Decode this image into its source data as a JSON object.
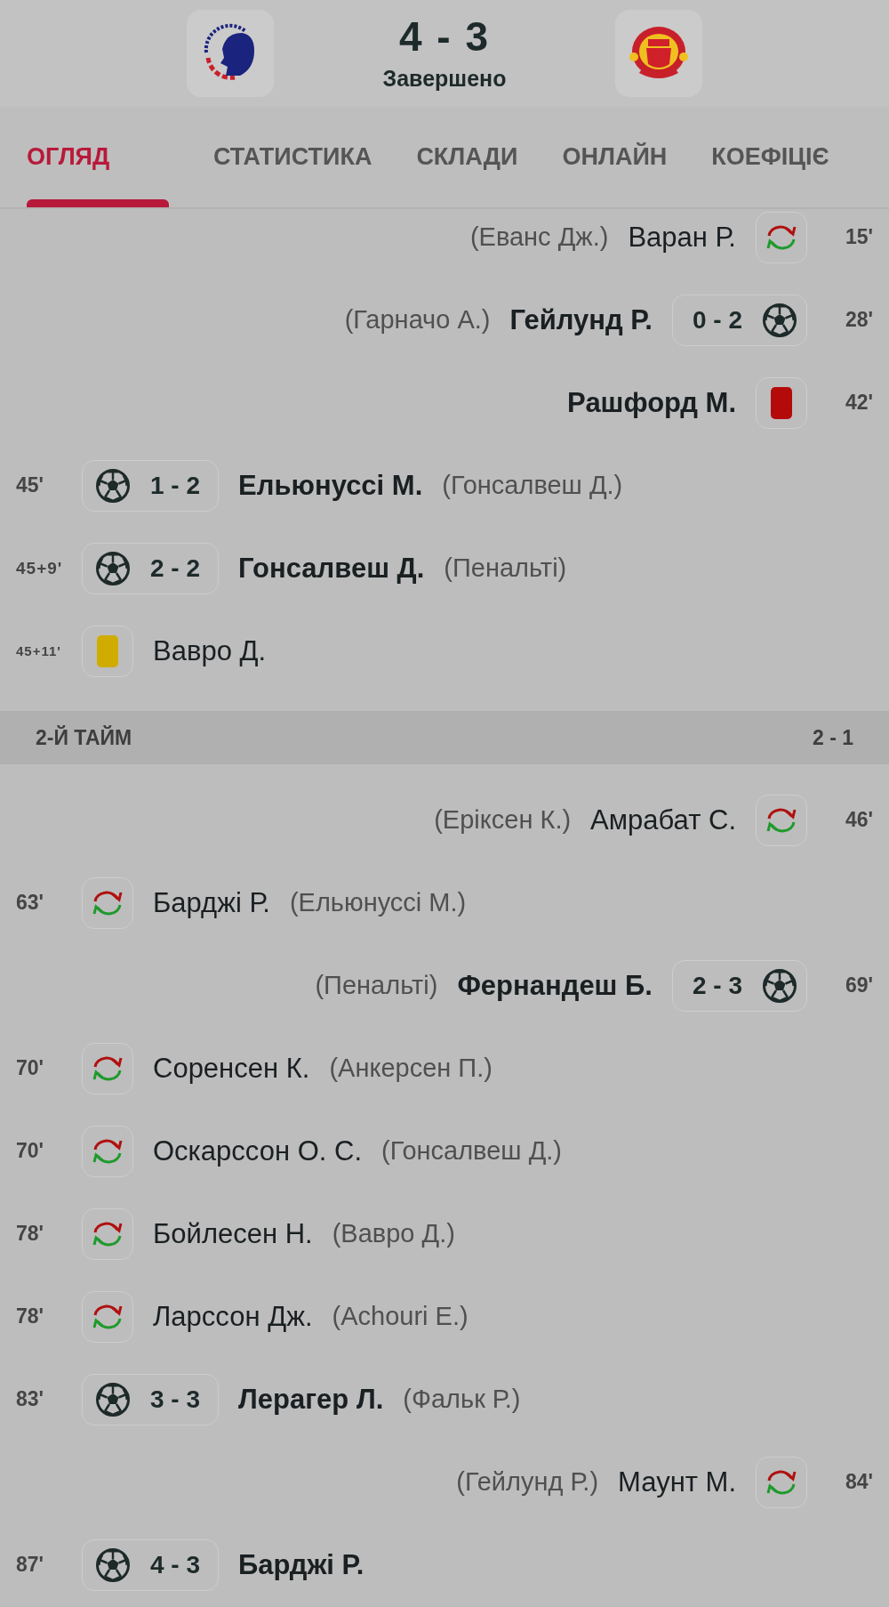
{
  "match": {
    "score": "4 - 3",
    "status": "Завершено"
  },
  "tabs": [
    {
      "label": "ОГЛЯД",
      "selected": true
    },
    {
      "label": "СТАТИСТИКА",
      "selected": false
    },
    {
      "label": "СКЛАДИ",
      "selected": false
    },
    {
      "label": "ОНЛАЙН",
      "selected": false
    },
    {
      "label": "КОЕФІЦІЄ",
      "selected": false
    }
  ],
  "timeline": [
    {
      "kind": "substitution",
      "away": true,
      "minute": "15'",
      "player": "Варан Р.",
      "note": "(Еванс Дж.)"
    },
    {
      "kind": "goal",
      "away": true,
      "minute": "28'",
      "player": "Гейлунд Р.",
      "note": "(Гарначо А.)",
      "score": "0 - 2"
    },
    {
      "kind": "red_card",
      "away": true,
      "minute": "42'",
      "player": "Рашфорд М."
    },
    {
      "kind": "goal",
      "away": false,
      "minute": "45'",
      "player": "Ельюнуссі М.",
      "note": "(Гонсалвеш Д.)",
      "score": "1 - 2"
    },
    {
      "kind": "goal",
      "away": false,
      "minute": "45+9'",
      "player": "Гонсалвеш Д.",
      "note": "(Пенальті)",
      "score": "2 - 2"
    },
    {
      "kind": "yellow_card",
      "away": false,
      "minute": "45+11'",
      "player": "Вавро Д."
    },
    {
      "kind": "period",
      "title": "2-Й ТАЙМ",
      "score": "2 - 1"
    },
    {
      "kind": "substitution",
      "away": true,
      "minute": "46'",
      "player": "Амрабат С.",
      "note": "(Еріксен К.)"
    },
    {
      "kind": "substitution",
      "away": false,
      "minute": "63'",
      "player": "Барджі Р.",
      "note": "(Ельюнуссі М.)"
    },
    {
      "kind": "goal",
      "away": true,
      "minute": "69'",
      "player": "Фернандеш Б.",
      "note": "(Пенальті)",
      "score": "2 - 3"
    },
    {
      "kind": "substitution",
      "away": false,
      "minute": "70'",
      "player": "Соренсен К.",
      "note": "(Анкерсен П.)"
    },
    {
      "kind": "substitution",
      "away": false,
      "minute": "70'",
      "player": "Оскарссон О. С.",
      "note": "(Гонсалвеш Д.)"
    },
    {
      "kind": "substitution",
      "away": false,
      "minute": "78'",
      "player": "Бойлесен Н.",
      "note": "(Вавро Д.)"
    },
    {
      "kind": "substitution",
      "away": false,
      "minute": "78'",
      "player": "Ларссон Дж.",
      "note": "(Achouri E.)"
    },
    {
      "kind": "goal",
      "away": false,
      "minute": "83'",
      "player": "Лерагер Л.",
      "note": "(Фальк Р.)",
      "score": "3 - 3"
    },
    {
      "kind": "substitution",
      "away": true,
      "minute": "84'",
      "player": "Маунт М.",
      "note": "(Гейлунд Р.)"
    },
    {
      "kind": "goal",
      "away": false,
      "minute": "87'",
      "player": "Барджі Р.",
      "score": "4 - 3"
    }
  ]
}
